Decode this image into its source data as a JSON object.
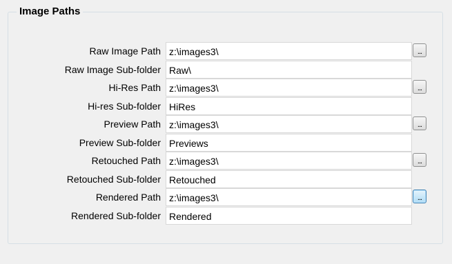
{
  "group": {
    "title": "Image Paths"
  },
  "rows": [
    {
      "label": "Raw Image Path",
      "value": "z:\\images3\\",
      "browse": "..."
    },
    {
      "label": "Raw Image Sub-folder",
      "value": "Raw\\"
    },
    {
      "label": "Hi-Res Path",
      "value": "z:\\images3\\",
      "browse": "..."
    },
    {
      "label": "Hi-res Sub-folder",
      "value": "HiRes"
    },
    {
      "label": "Preview Path",
      "value": "z:\\images3\\",
      "browse": "..."
    },
    {
      "label": "Preview Sub-folder",
      "value": "Previews"
    },
    {
      "label": "Retouched Path",
      "value": "z:\\images3\\",
      "browse": "..."
    },
    {
      "label": "Retouched Sub-folder",
      "value": "Retouched"
    },
    {
      "label": "Rendered Path",
      "value": "z:\\images3\\",
      "browse": "..."
    },
    {
      "label": "Rendered Sub-folder",
      "value": "Rendered"
    }
  ],
  "colors": {
    "background": "#f0f0f0",
    "group_border": "#d5dfe5",
    "field_border": "#d8d8d8",
    "active_button_border": "#3c7fb1"
  }
}
